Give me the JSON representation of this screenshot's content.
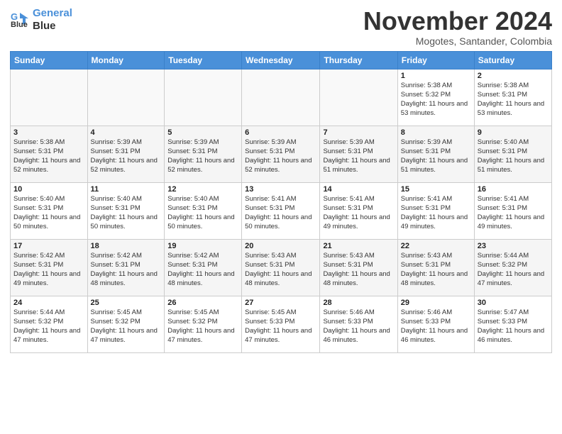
{
  "header": {
    "logo_line1": "General",
    "logo_line2": "Blue",
    "month_title": "November 2024",
    "location": "Mogotes, Santander, Colombia"
  },
  "days_of_week": [
    "Sunday",
    "Monday",
    "Tuesday",
    "Wednesday",
    "Thursday",
    "Friday",
    "Saturday"
  ],
  "weeks": [
    {
      "days": [
        {
          "num": "",
          "info": ""
        },
        {
          "num": "",
          "info": ""
        },
        {
          "num": "",
          "info": ""
        },
        {
          "num": "",
          "info": ""
        },
        {
          "num": "",
          "info": ""
        },
        {
          "num": "1",
          "info": "Sunrise: 5:38 AM\nSunset: 5:32 PM\nDaylight: 11 hours and 53 minutes."
        },
        {
          "num": "2",
          "info": "Sunrise: 5:38 AM\nSunset: 5:31 PM\nDaylight: 11 hours and 53 minutes."
        }
      ]
    },
    {
      "days": [
        {
          "num": "3",
          "info": "Sunrise: 5:38 AM\nSunset: 5:31 PM\nDaylight: 11 hours and 52 minutes."
        },
        {
          "num": "4",
          "info": "Sunrise: 5:39 AM\nSunset: 5:31 PM\nDaylight: 11 hours and 52 minutes."
        },
        {
          "num": "5",
          "info": "Sunrise: 5:39 AM\nSunset: 5:31 PM\nDaylight: 11 hours and 52 minutes."
        },
        {
          "num": "6",
          "info": "Sunrise: 5:39 AM\nSunset: 5:31 PM\nDaylight: 11 hours and 52 minutes."
        },
        {
          "num": "7",
          "info": "Sunrise: 5:39 AM\nSunset: 5:31 PM\nDaylight: 11 hours and 51 minutes."
        },
        {
          "num": "8",
          "info": "Sunrise: 5:39 AM\nSunset: 5:31 PM\nDaylight: 11 hours and 51 minutes."
        },
        {
          "num": "9",
          "info": "Sunrise: 5:40 AM\nSunset: 5:31 PM\nDaylight: 11 hours and 51 minutes."
        }
      ]
    },
    {
      "days": [
        {
          "num": "10",
          "info": "Sunrise: 5:40 AM\nSunset: 5:31 PM\nDaylight: 11 hours and 50 minutes."
        },
        {
          "num": "11",
          "info": "Sunrise: 5:40 AM\nSunset: 5:31 PM\nDaylight: 11 hours and 50 minutes."
        },
        {
          "num": "12",
          "info": "Sunrise: 5:40 AM\nSunset: 5:31 PM\nDaylight: 11 hours and 50 minutes."
        },
        {
          "num": "13",
          "info": "Sunrise: 5:41 AM\nSunset: 5:31 PM\nDaylight: 11 hours and 50 minutes."
        },
        {
          "num": "14",
          "info": "Sunrise: 5:41 AM\nSunset: 5:31 PM\nDaylight: 11 hours and 49 minutes."
        },
        {
          "num": "15",
          "info": "Sunrise: 5:41 AM\nSunset: 5:31 PM\nDaylight: 11 hours and 49 minutes."
        },
        {
          "num": "16",
          "info": "Sunrise: 5:41 AM\nSunset: 5:31 PM\nDaylight: 11 hours and 49 minutes."
        }
      ]
    },
    {
      "days": [
        {
          "num": "17",
          "info": "Sunrise: 5:42 AM\nSunset: 5:31 PM\nDaylight: 11 hours and 49 minutes."
        },
        {
          "num": "18",
          "info": "Sunrise: 5:42 AM\nSunset: 5:31 PM\nDaylight: 11 hours and 48 minutes."
        },
        {
          "num": "19",
          "info": "Sunrise: 5:42 AM\nSunset: 5:31 PM\nDaylight: 11 hours and 48 minutes."
        },
        {
          "num": "20",
          "info": "Sunrise: 5:43 AM\nSunset: 5:31 PM\nDaylight: 11 hours and 48 minutes."
        },
        {
          "num": "21",
          "info": "Sunrise: 5:43 AM\nSunset: 5:31 PM\nDaylight: 11 hours and 48 minutes."
        },
        {
          "num": "22",
          "info": "Sunrise: 5:43 AM\nSunset: 5:31 PM\nDaylight: 11 hours and 48 minutes."
        },
        {
          "num": "23",
          "info": "Sunrise: 5:44 AM\nSunset: 5:32 PM\nDaylight: 11 hours and 47 minutes."
        }
      ]
    },
    {
      "days": [
        {
          "num": "24",
          "info": "Sunrise: 5:44 AM\nSunset: 5:32 PM\nDaylight: 11 hours and 47 minutes."
        },
        {
          "num": "25",
          "info": "Sunrise: 5:45 AM\nSunset: 5:32 PM\nDaylight: 11 hours and 47 minutes."
        },
        {
          "num": "26",
          "info": "Sunrise: 5:45 AM\nSunset: 5:32 PM\nDaylight: 11 hours and 47 minutes."
        },
        {
          "num": "27",
          "info": "Sunrise: 5:45 AM\nSunset: 5:33 PM\nDaylight: 11 hours and 47 minutes."
        },
        {
          "num": "28",
          "info": "Sunrise: 5:46 AM\nSunset: 5:33 PM\nDaylight: 11 hours and 46 minutes."
        },
        {
          "num": "29",
          "info": "Sunrise: 5:46 AM\nSunset: 5:33 PM\nDaylight: 11 hours and 46 minutes."
        },
        {
          "num": "30",
          "info": "Sunrise: 5:47 AM\nSunset: 5:33 PM\nDaylight: 11 hours and 46 minutes."
        }
      ]
    }
  ]
}
